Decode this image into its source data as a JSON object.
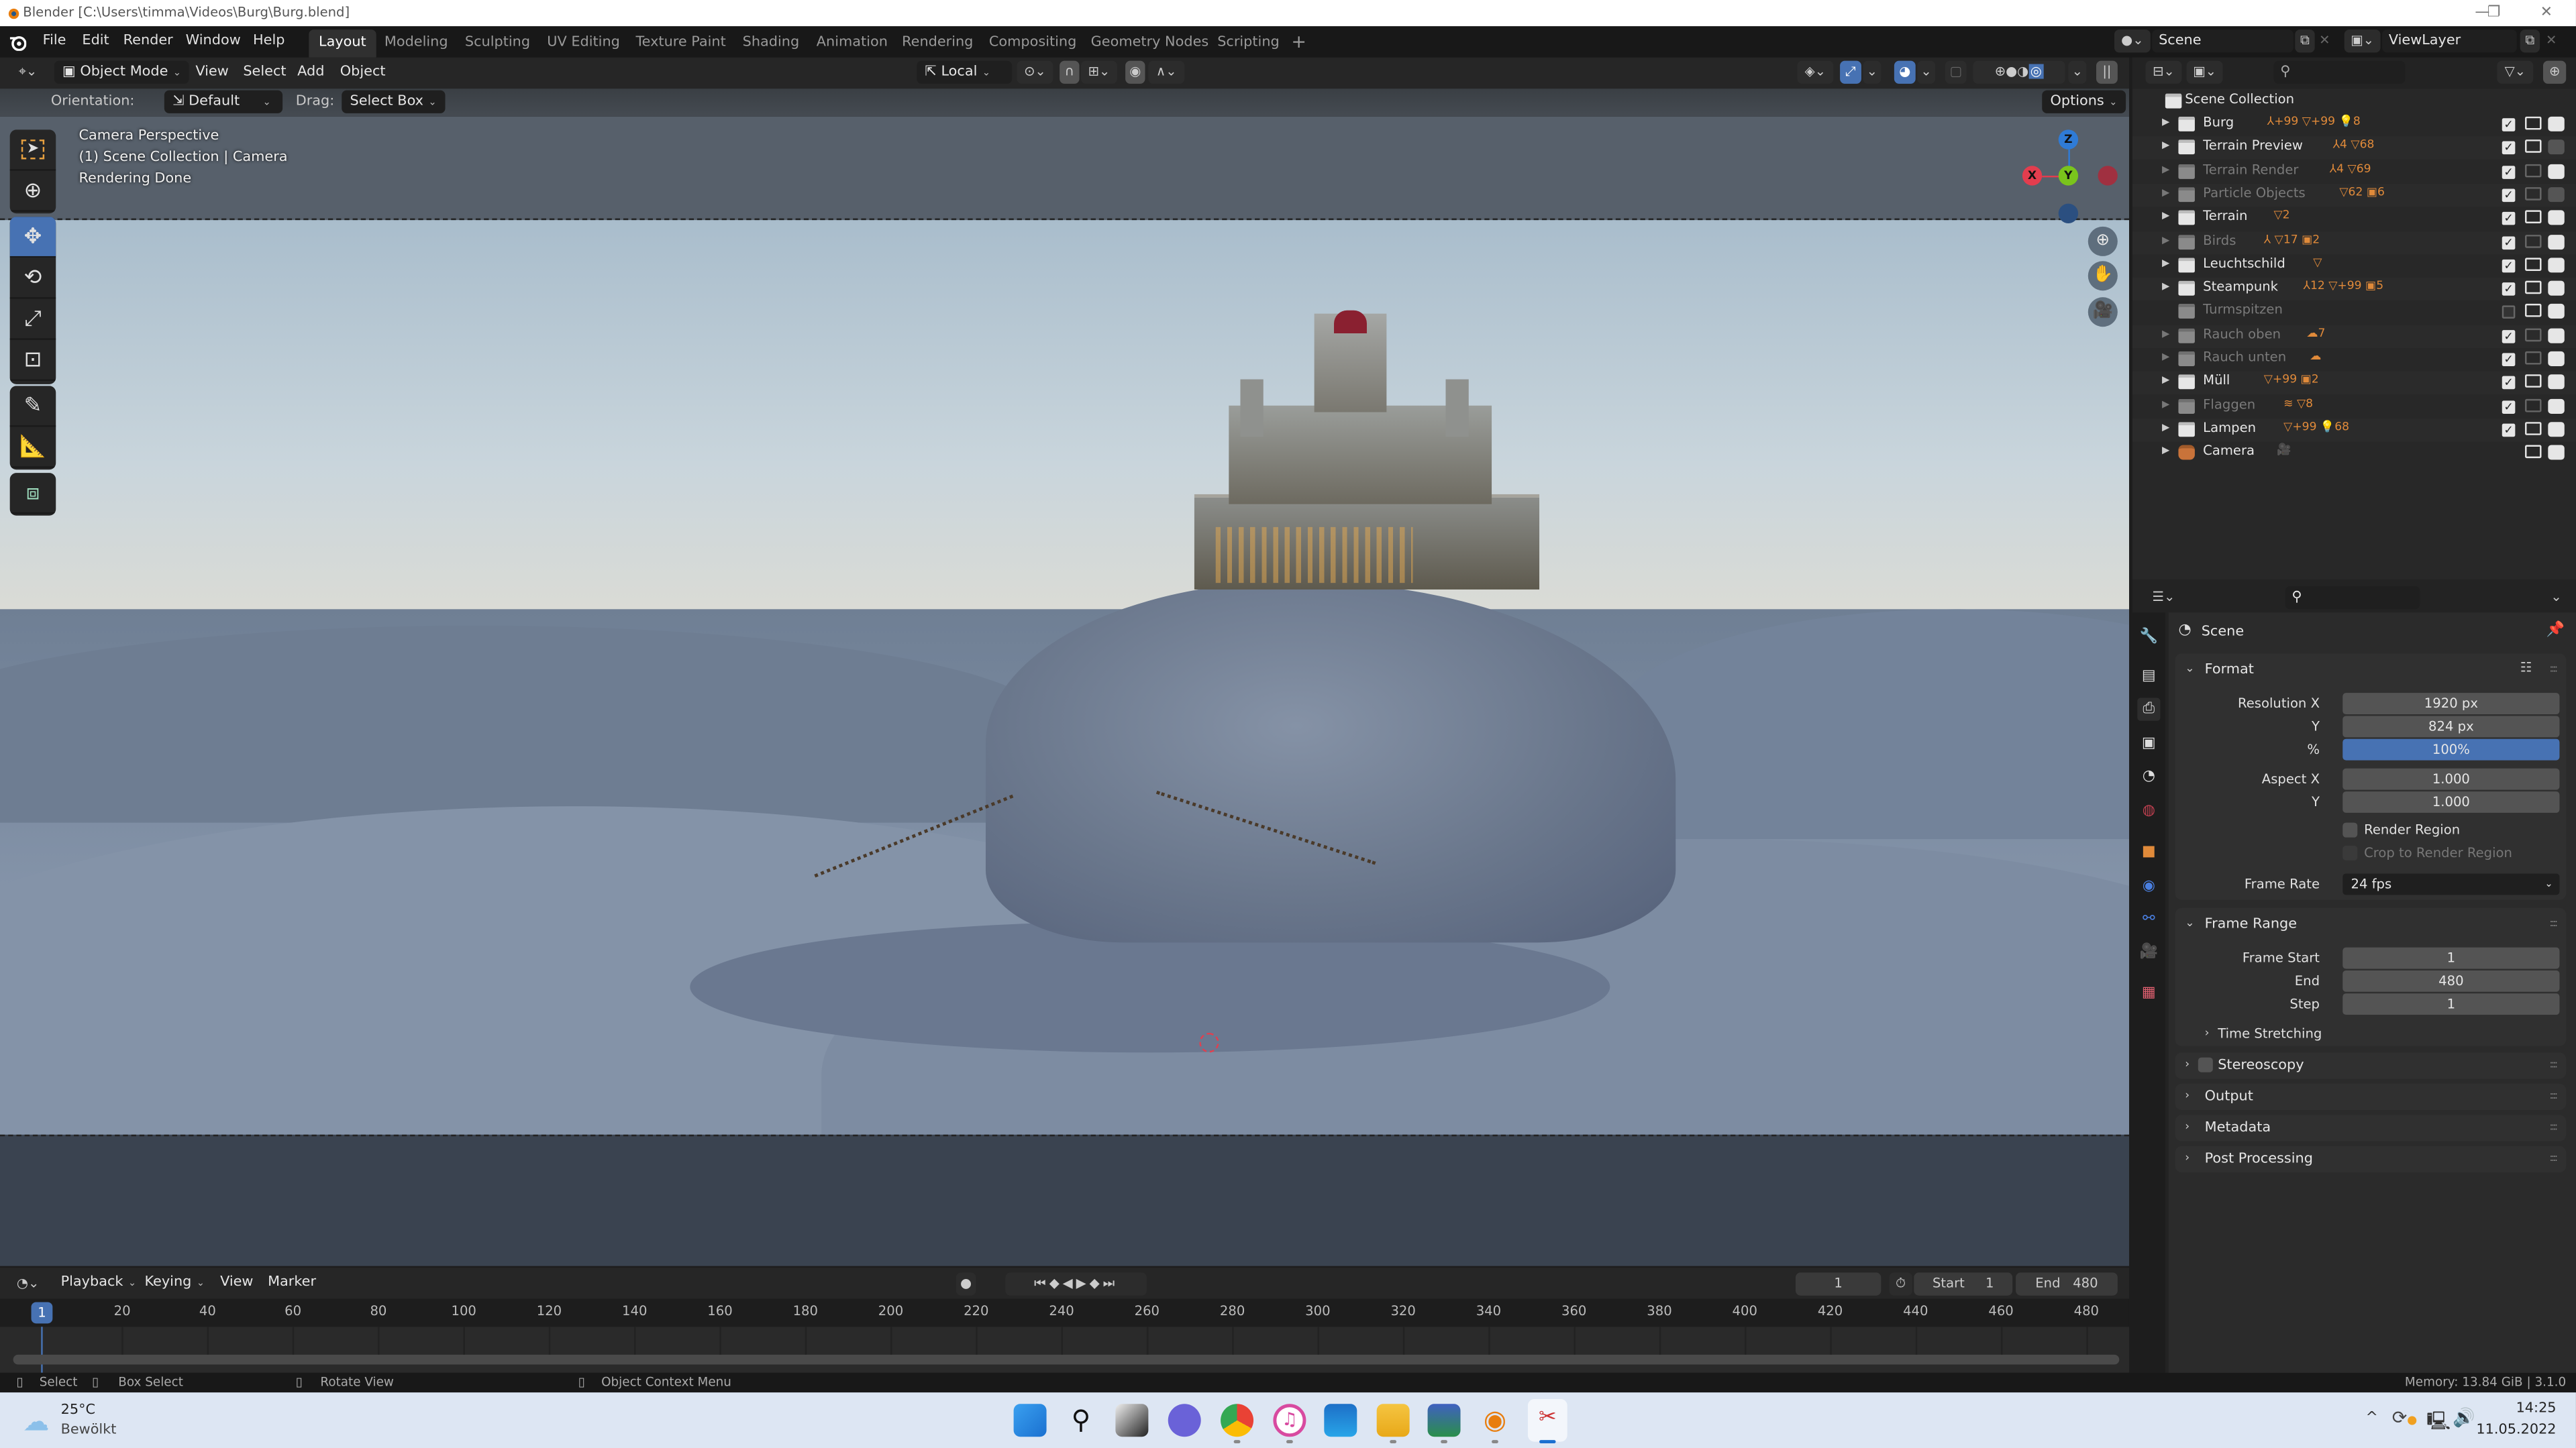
{
  "window": {
    "title": "Blender [C:\\Users\\timma\\Videos\\Burg\\Burg.blend]",
    "controls": {
      "minimize": "—",
      "maximize": "❐",
      "close": "✕"
    }
  },
  "topbar": {
    "menus": [
      "File",
      "Edit",
      "Render",
      "Window",
      "Help"
    ],
    "workspaces": [
      {
        "label": "Layout",
        "active": true
      },
      {
        "label": "Modeling",
        "active": false
      },
      {
        "label": "Sculpting",
        "active": false
      },
      {
        "label": "UV Editing",
        "active": false
      },
      {
        "label": "Texture Paint",
        "active": false
      },
      {
        "label": "Shading",
        "active": false
      },
      {
        "label": "Animation",
        "active": false
      },
      {
        "label": "Rendering",
        "active": false
      },
      {
        "label": "Compositing",
        "active": false
      },
      {
        "label": "Geometry Nodes",
        "active": false
      },
      {
        "label": "Scripting",
        "active": false
      }
    ],
    "add_workspace": "+",
    "scene": "Scene",
    "view_layer": "ViewLayer"
  },
  "viewport_header": {
    "mode": "Object Mode",
    "menus": [
      "View",
      "Select",
      "Add",
      "Object"
    ],
    "transform_orientation": "Local",
    "pause_icon": "||"
  },
  "tool_header": {
    "orientation_label": "Orientation:",
    "orientation_value": "Default",
    "drag_label": "Drag:",
    "drag_value": "Select Box",
    "options": "Options"
  },
  "viewport": {
    "overlay_lines": [
      "Camera Perspective",
      "(1) Scene Collection | Camera",
      "Rendering Done"
    ],
    "gizmo": {
      "x": "X",
      "y": "Y",
      "z": "Z"
    },
    "colors": {
      "x": "#e33d4e",
      "y": "#7ac41c",
      "z": "#2f7bd6",
      "active_tool": "#4772b3"
    }
  },
  "timeline": {
    "menus": [
      "Playback",
      "Keying",
      "View",
      "Marker"
    ],
    "current_frame": "1",
    "start_label": "Start",
    "start": "1",
    "end_label": "End",
    "end": "480",
    "ticks": [
      "20",
      "40",
      "60",
      "80",
      "100",
      "120",
      "140",
      "160",
      "180",
      "200",
      "220",
      "240",
      "260",
      "280",
      "300",
      "320",
      "340",
      "360",
      "380",
      "400",
      "420",
      "440",
      "460",
      "480"
    ],
    "playhead": "1"
  },
  "statusbar": {
    "select": "Select",
    "box_select": "Box Select",
    "rotate_view": "Rotate View",
    "context_menu": "Object Context Menu",
    "memory": "Memory: 13.84 GiB | 3.1.0"
  },
  "outliner": {
    "root": "Scene Collection",
    "items": [
      {
        "name": "Burg",
        "badges": "⅄+99 ▽+99 💡8",
        "dim": false,
        "checked": true,
        "viewport": true,
        "render": true
      },
      {
        "name": "Terrain Preview",
        "badges": "⅄4 ▽68",
        "dim": false,
        "checked": true,
        "viewport": true,
        "render": false
      },
      {
        "name": "Terrain Render",
        "badges": "⅄4 ▽69",
        "dim": true,
        "checked": true,
        "viewport": false,
        "render": true
      },
      {
        "name": "Particle Objects",
        "badges": "▽62 ▣6",
        "dim": true,
        "checked": true,
        "viewport": false,
        "render": false
      },
      {
        "name": "Terrain",
        "badges": "▽2",
        "dim": false,
        "checked": true,
        "viewport": true,
        "render": true
      },
      {
        "name": "Birds",
        "badges": "⅄ ▽17 ▣2",
        "dim": true,
        "checked": true,
        "viewport": false,
        "render": true
      },
      {
        "name": "Leuchtschild",
        "badges": "▽",
        "dim": false,
        "checked": true,
        "viewport": true,
        "render": true
      },
      {
        "name": "Steampunk",
        "badges": "⅄12 ▽+99 ▣5",
        "dim": false,
        "checked": true,
        "viewport": true,
        "render": true
      },
      {
        "name": "Turmspitzen",
        "badges": "",
        "dim": true,
        "checked": false,
        "viewport": true,
        "render": true
      },
      {
        "name": "Rauch oben",
        "badges": "☁7",
        "dim": true,
        "checked": true,
        "viewport": false,
        "render": true
      },
      {
        "name": "Rauch unten",
        "badges": "☁",
        "dim": true,
        "checked": true,
        "viewport": false,
        "render": true
      },
      {
        "name": "Müll",
        "badges": "▽+99 ▣2",
        "dim": false,
        "checked": true,
        "viewport": true,
        "render": true
      },
      {
        "name": "Flaggen",
        "badges": "≋ ▽8",
        "dim": true,
        "checked": true,
        "viewport": false,
        "render": true
      },
      {
        "name": "Lampen",
        "badges": "▽+99 💡68",
        "dim": false,
        "checked": true,
        "viewport": true,
        "render": true
      },
      {
        "name": "Camera",
        "badges": "🎥",
        "dim": false,
        "checked": null,
        "viewport": true,
        "render": true
      }
    ]
  },
  "properties": {
    "context": "Scene",
    "format": {
      "title": "Format",
      "resolution_x_label": "Resolution X",
      "resolution_x": "1920 px",
      "resolution_y_label": "Y",
      "resolution_y": "824 px",
      "percent_label": "%",
      "percent": "100%",
      "aspect_x_label": "Aspect X",
      "aspect_x": "1.000",
      "aspect_y_label": "Y",
      "aspect_y": "1.000",
      "render_region": "Render Region",
      "crop_region": "Crop to Render Region",
      "frame_rate_label": "Frame Rate",
      "frame_rate": "24 fps"
    },
    "frame_range": {
      "title": "Frame Range",
      "start_label": "Frame Start",
      "start": "1",
      "end_label": "End",
      "end": "480",
      "step_label": "Step",
      "step": "1",
      "time_stretching": "Time Stretching"
    },
    "collapsed_panels": [
      "Stereoscopy",
      "Output",
      "Metadata",
      "Post Processing"
    ]
  },
  "taskbar": {
    "weather_temp": "25°C",
    "weather_desc": "Bewölkt",
    "time": "14:25",
    "date": "11.05.2022",
    "tray_chevron": "^"
  }
}
